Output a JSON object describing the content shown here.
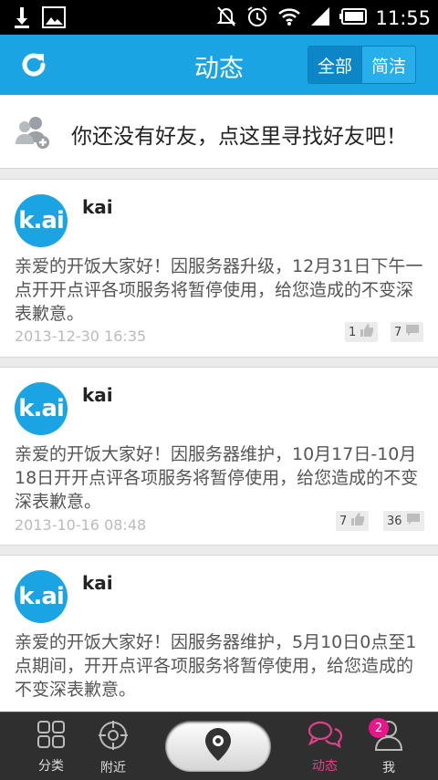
{
  "status": {
    "time": "11:55"
  },
  "header": {
    "title": "动态",
    "seg_all": "全部",
    "seg_simple": "简洁"
  },
  "friend_prompt": "你还没有好友，点这里寻找好友吧！",
  "posts": [
    {
      "avatar": "k.ai",
      "name": "kai",
      "body": "亲爱的开饭大家好！因服务器升级，12月31日下午一点开开点评各项服务将暂停使用，给您造成的不变深表歉意。",
      "date": "2013-12-30 16:35",
      "likes": "1",
      "comments": "7"
    },
    {
      "avatar": "k.ai",
      "name": "kai",
      "body": "亲爱的开饭大家好！因服务器维护，10月17日-10月18日开开点评各项服务将暂停使用，给您造成的不变深表歉意。",
      "date": "2013-10-16 08:48",
      "likes": "7",
      "comments": "36"
    },
    {
      "avatar": "k.ai",
      "name": "kai",
      "body": "亲爱的开饭大家好！因服务器维护，5月10日0点至1点期间，开开点评各项服务将暂停使用，给您造成的不变深表歉意。"
    }
  ],
  "tabbar": {
    "category": "分类",
    "nearby": "附近",
    "feed": "动态",
    "me": "我",
    "me_badge": "2"
  },
  "colors": {
    "accent": "#1ba4e3",
    "active_tab": "#e0408a"
  }
}
